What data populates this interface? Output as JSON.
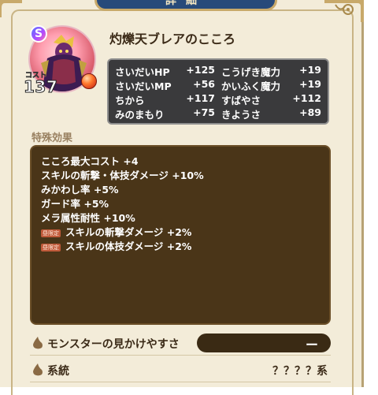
{
  "header": {
    "title": "詳細"
  },
  "monster": {
    "rank": "S",
    "cost_label": "コスト",
    "cost": "137",
    "heart_name": "灼爍天ブレアのこころ"
  },
  "stats": [
    {
      "left_label": "さいだいHP",
      "left_value": "+125",
      "right_label": "こうげき魔力",
      "right_value": "+19"
    },
    {
      "left_label": "さいだいMP",
      "left_value": "+56",
      "right_label": "かいふく魔力",
      "right_value": "+19"
    },
    {
      "left_label": "ちから",
      "left_value": "+117",
      "right_label": "すばやさ",
      "right_value": "+112"
    },
    {
      "left_label": "みのまもり",
      "left_value": "+75",
      "right_label": "きようさ",
      "right_value": "+89"
    }
  ],
  "special": {
    "label": "特殊効果",
    "effects": [
      {
        "text": "こころ最大コスト +4",
        "tag": ""
      },
      {
        "text": "スキルの斬撃・体技ダメージ +10%",
        "tag": ""
      },
      {
        "text": "みかわし率 +5%",
        "tag": ""
      },
      {
        "text": "ガード率 +5%",
        "tag": ""
      },
      {
        "text": "メラ属性耐性 +10%",
        "tag": ""
      },
      {
        "text": "スキルの斬撃ダメージ +2%",
        "tag": "昼限定"
      },
      {
        "text": "スキルの体技ダメージ +2%",
        "tag": "昼限定"
      }
    ]
  },
  "settings": {
    "visibility_label": "モンスターの見かけやすさ",
    "visibility_value": "ー",
    "lineage_label": "系統",
    "lineage_value": "？？？？系"
  },
  "colors": {
    "panel_bg": "#f3ecd9",
    "stats_bg": "#3a3a3c",
    "effects_bg": "#4a3518",
    "tab_bg": "#274a7a"
  }
}
